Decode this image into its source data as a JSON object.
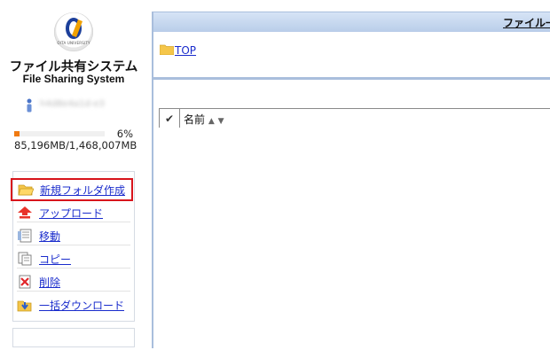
{
  "app": {
    "logo_text": "OITA UNIVERSITY",
    "title": "ファイル共有システム",
    "subtitle": "File Sharing System"
  },
  "user": {
    "name": "h4d8e4a1d-e3"
  },
  "quota": {
    "percent_label": "6%",
    "percent_value": 6,
    "usage": "85,196MB/1,468,007MB"
  },
  "menu": {
    "items": [
      {
        "label": "新規フォルダ作成",
        "icon": "folder-open-icon",
        "selected": true
      },
      {
        "label": "アップロード",
        "icon": "upload-arrow-icon"
      },
      {
        "label": "移動",
        "icon": "move-icon"
      },
      {
        "label": "コピー",
        "icon": "copy-icon"
      },
      {
        "label": "削除",
        "icon": "delete-icon"
      },
      {
        "label": "一括ダウンロード",
        "icon": "bulk-download-icon"
      }
    ]
  },
  "main": {
    "header_title": "ファイル一",
    "breadcrumb": "TOP",
    "columns": {
      "check": "✔",
      "name": "名前",
      "sort_asc": "▲",
      "sort_desc": "▼"
    }
  },
  "colors": {
    "link": "#1a2ccc",
    "header": "#c7d7ef",
    "quota": "#f07a12",
    "selection": "#d8141c"
  }
}
